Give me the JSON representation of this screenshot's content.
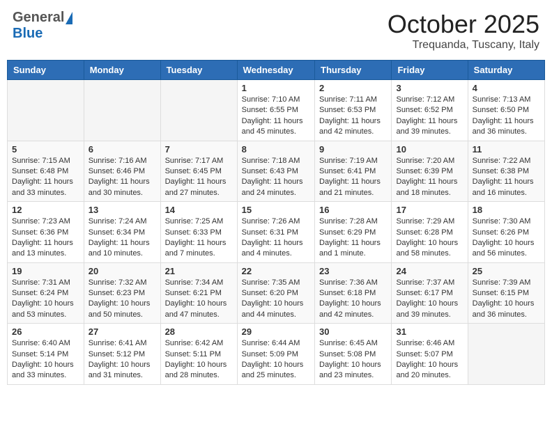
{
  "header": {
    "logo_general": "General",
    "logo_blue": "Blue",
    "month_title": "October 2025",
    "location": "Trequanda, Tuscany, Italy"
  },
  "days_of_week": [
    "Sunday",
    "Monday",
    "Tuesday",
    "Wednesday",
    "Thursday",
    "Friday",
    "Saturday"
  ],
  "weeks": [
    [
      {
        "day": "",
        "info": ""
      },
      {
        "day": "",
        "info": ""
      },
      {
        "day": "",
        "info": ""
      },
      {
        "day": "1",
        "info": "Sunrise: 7:10 AM\nSunset: 6:55 PM\nDaylight: 11 hours and 45 minutes."
      },
      {
        "day": "2",
        "info": "Sunrise: 7:11 AM\nSunset: 6:53 PM\nDaylight: 11 hours and 42 minutes."
      },
      {
        "day": "3",
        "info": "Sunrise: 7:12 AM\nSunset: 6:52 PM\nDaylight: 11 hours and 39 minutes."
      },
      {
        "day": "4",
        "info": "Sunrise: 7:13 AM\nSunset: 6:50 PM\nDaylight: 11 hours and 36 minutes."
      }
    ],
    [
      {
        "day": "5",
        "info": "Sunrise: 7:15 AM\nSunset: 6:48 PM\nDaylight: 11 hours and 33 minutes."
      },
      {
        "day": "6",
        "info": "Sunrise: 7:16 AM\nSunset: 6:46 PM\nDaylight: 11 hours and 30 minutes."
      },
      {
        "day": "7",
        "info": "Sunrise: 7:17 AM\nSunset: 6:45 PM\nDaylight: 11 hours and 27 minutes."
      },
      {
        "day": "8",
        "info": "Sunrise: 7:18 AM\nSunset: 6:43 PM\nDaylight: 11 hours and 24 minutes."
      },
      {
        "day": "9",
        "info": "Sunrise: 7:19 AM\nSunset: 6:41 PM\nDaylight: 11 hours and 21 minutes."
      },
      {
        "day": "10",
        "info": "Sunrise: 7:20 AM\nSunset: 6:39 PM\nDaylight: 11 hours and 18 minutes."
      },
      {
        "day": "11",
        "info": "Sunrise: 7:22 AM\nSunset: 6:38 PM\nDaylight: 11 hours and 16 minutes."
      }
    ],
    [
      {
        "day": "12",
        "info": "Sunrise: 7:23 AM\nSunset: 6:36 PM\nDaylight: 11 hours and 13 minutes."
      },
      {
        "day": "13",
        "info": "Sunrise: 7:24 AM\nSunset: 6:34 PM\nDaylight: 11 hours and 10 minutes."
      },
      {
        "day": "14",
        "info": "Sunrise: 7:25 AM\nSunset: 6:33 PM\nDaylight: 11 hours and 7 minutes."
      },
      {
        "day": "15",
        "info": "Sunrise: 7:26 AM\nSunset: 6:31 PM\nDaylight: 11 hours and 4 minutes."
      },
      {
        "day": "16",
        "info": "Sunrise: 7:28 AM\nSunset: 6:29 PM\nDaylight: 11 hours and 1 minute."
      },
      {
        "day": "17",
        "info": "Sunrise: 7:29 AM\nSunset: 6:28 PM\nDaylight: 10 hours and 58 minutes."
      },
      {
        "day": "18",
        "info": "Sunrise: 7:30 AM\nSunset: 6:26 PM\nDaylight: 10 hours and 56 minutes."
      }
    ],
    [
      {
        "day": "19",
        "info": "Sunrise: 7:31 AM\nSunset: 6:24 PM\nDaylight: 10 hours and 53 minutes."
      },
      {
        "day": "20",
        "info": "Sunrise: 7:32 AM\nSunset: 6:23 PM\nDaylight: 10 hours and 50 minutes."
      },
      {
        "day": "21",
        "info": "Sunrise: 7:34 AM\nSunset: 6:21 PM\nDaylight: 10 hours and 47 minutes."
      },
      {
        "day": "22",
        "info": "Sunrise: 7:35 AM\nSunset: 6:20 PM\nDaylight: 10 hours and 44 minutes."
      },
      {
        "day": "23",
        "info": "Sunrise: 7:36 AM\nSunset: 6:18 PM\nDaylight: 10 hours and 42 minutes."
      },
      {
        "day": "24",
        "info": "Sunrise: 7:37 AM\nSunset: 6:17 PM\nDaylight: 10 hours and 39 minutes."
      },
      {
        "day": "25",
        "info": "Sunrise: 7:39 AM\nSunset: 6:15 PM\nDaylight: 10 hours and 36 minutes."
      }
    ],
    [
      {
        "day": "26",
        "info": "Sunrise: 6:40 AM\nSunset: 5:14 PM\nDaylight: 10 hours and 33 minutes."
      },
      {
        "day": "27",
        "info": "Sunrise: 6:41 AM\nSunset: 5:12 PM\nDaylight: 10 hours and 31 minutes."
      },
      {
        "day": "28",
        "info": "Sunrise: 6:42 AM\nSunset: 5:11 PM\nDaylight: 10 hours and 28 minutes."
      },
      {
        "day": "29",
        "info": "Sunrise: 6:44 AM\nSunset: 5:09 PM\nDaylight: 10 hours and 25 minutes."
      },
      {
        "day": "30",
        "info": "Sunrise: 6:45 AM\nSunset: 5:08 PM\nDaylight: 10 hours and 23 minutes."
      },
      {
        "day": "31",
        "info": "Sunrise: 6:46 AM\nSunset: 5:07 PM\nDaylight: 10 hours and 20 minutes."
      },
      {
        "day": "",
        "info": ""
      }
    ]
  ]
}
